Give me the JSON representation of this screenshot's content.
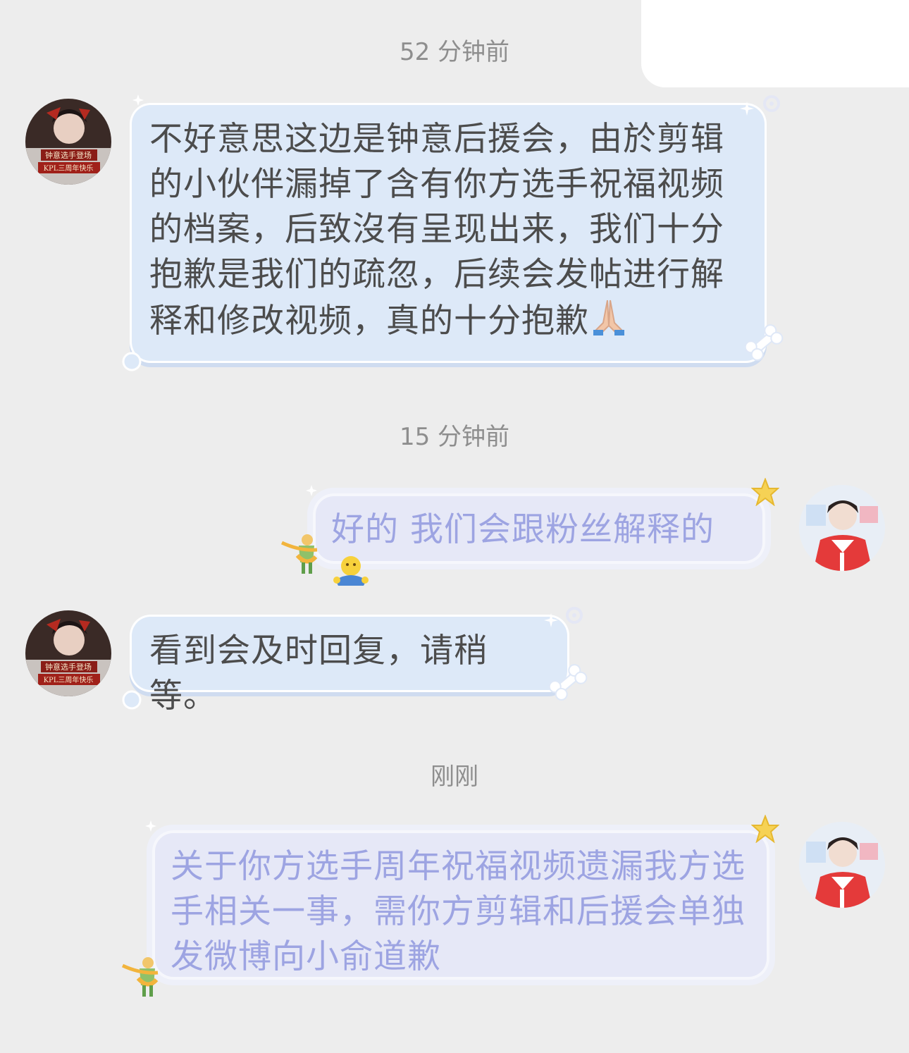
{
  "timestamps": {
    "t1": "52 分钟前",
    "t2": "15 分钟前",
    "t3": "刚刚"
  },
  "messages": [
    {
      "side": "incoming",
      "text": "不好意思这边是钟意后援会，由於剪辑的小伙伴漏掉了含有你方选手祝福视频的档案，后致沒有呈现出来，我们十分抱歉是我们的疏忽，后续会发帖进行解释和修改视频，真的十分抱歉",
      "trailing_icon": "praying-hands-icon"
    },
    {
      "side": "outgoing",
      "text": "好的 我们会跟粉丝解释的",
      "trailing_icon": "hugging-emoji-icon"
    },
    {
      "side": "incoming",
      "text": "看到会及时回复，请稍等。"
    },
    {
      "side": "outgoing",
      "text": "关于你方选手周年祝福视频遗漏我方选手相关一事，需你方剪辑和后援会单独发微博向小俞道歉"
    }
  ],
  "avatars": {
    "incoming_poster_text_1": "钟意选手登场",
    "incoming_poster_text_2": "KPL三周年快乐"
  },
  "colors": {
    "background": "#ededed",
    "incoming_bubble": "#dde9f8",
    "incoming_text": "#4c4c4c",
    "outgoing_bubble": "#e6e8f7",
    "outgoing_text": "#9da4e2",
    "timestamp_text": "#8e8e8e"
  }
}
